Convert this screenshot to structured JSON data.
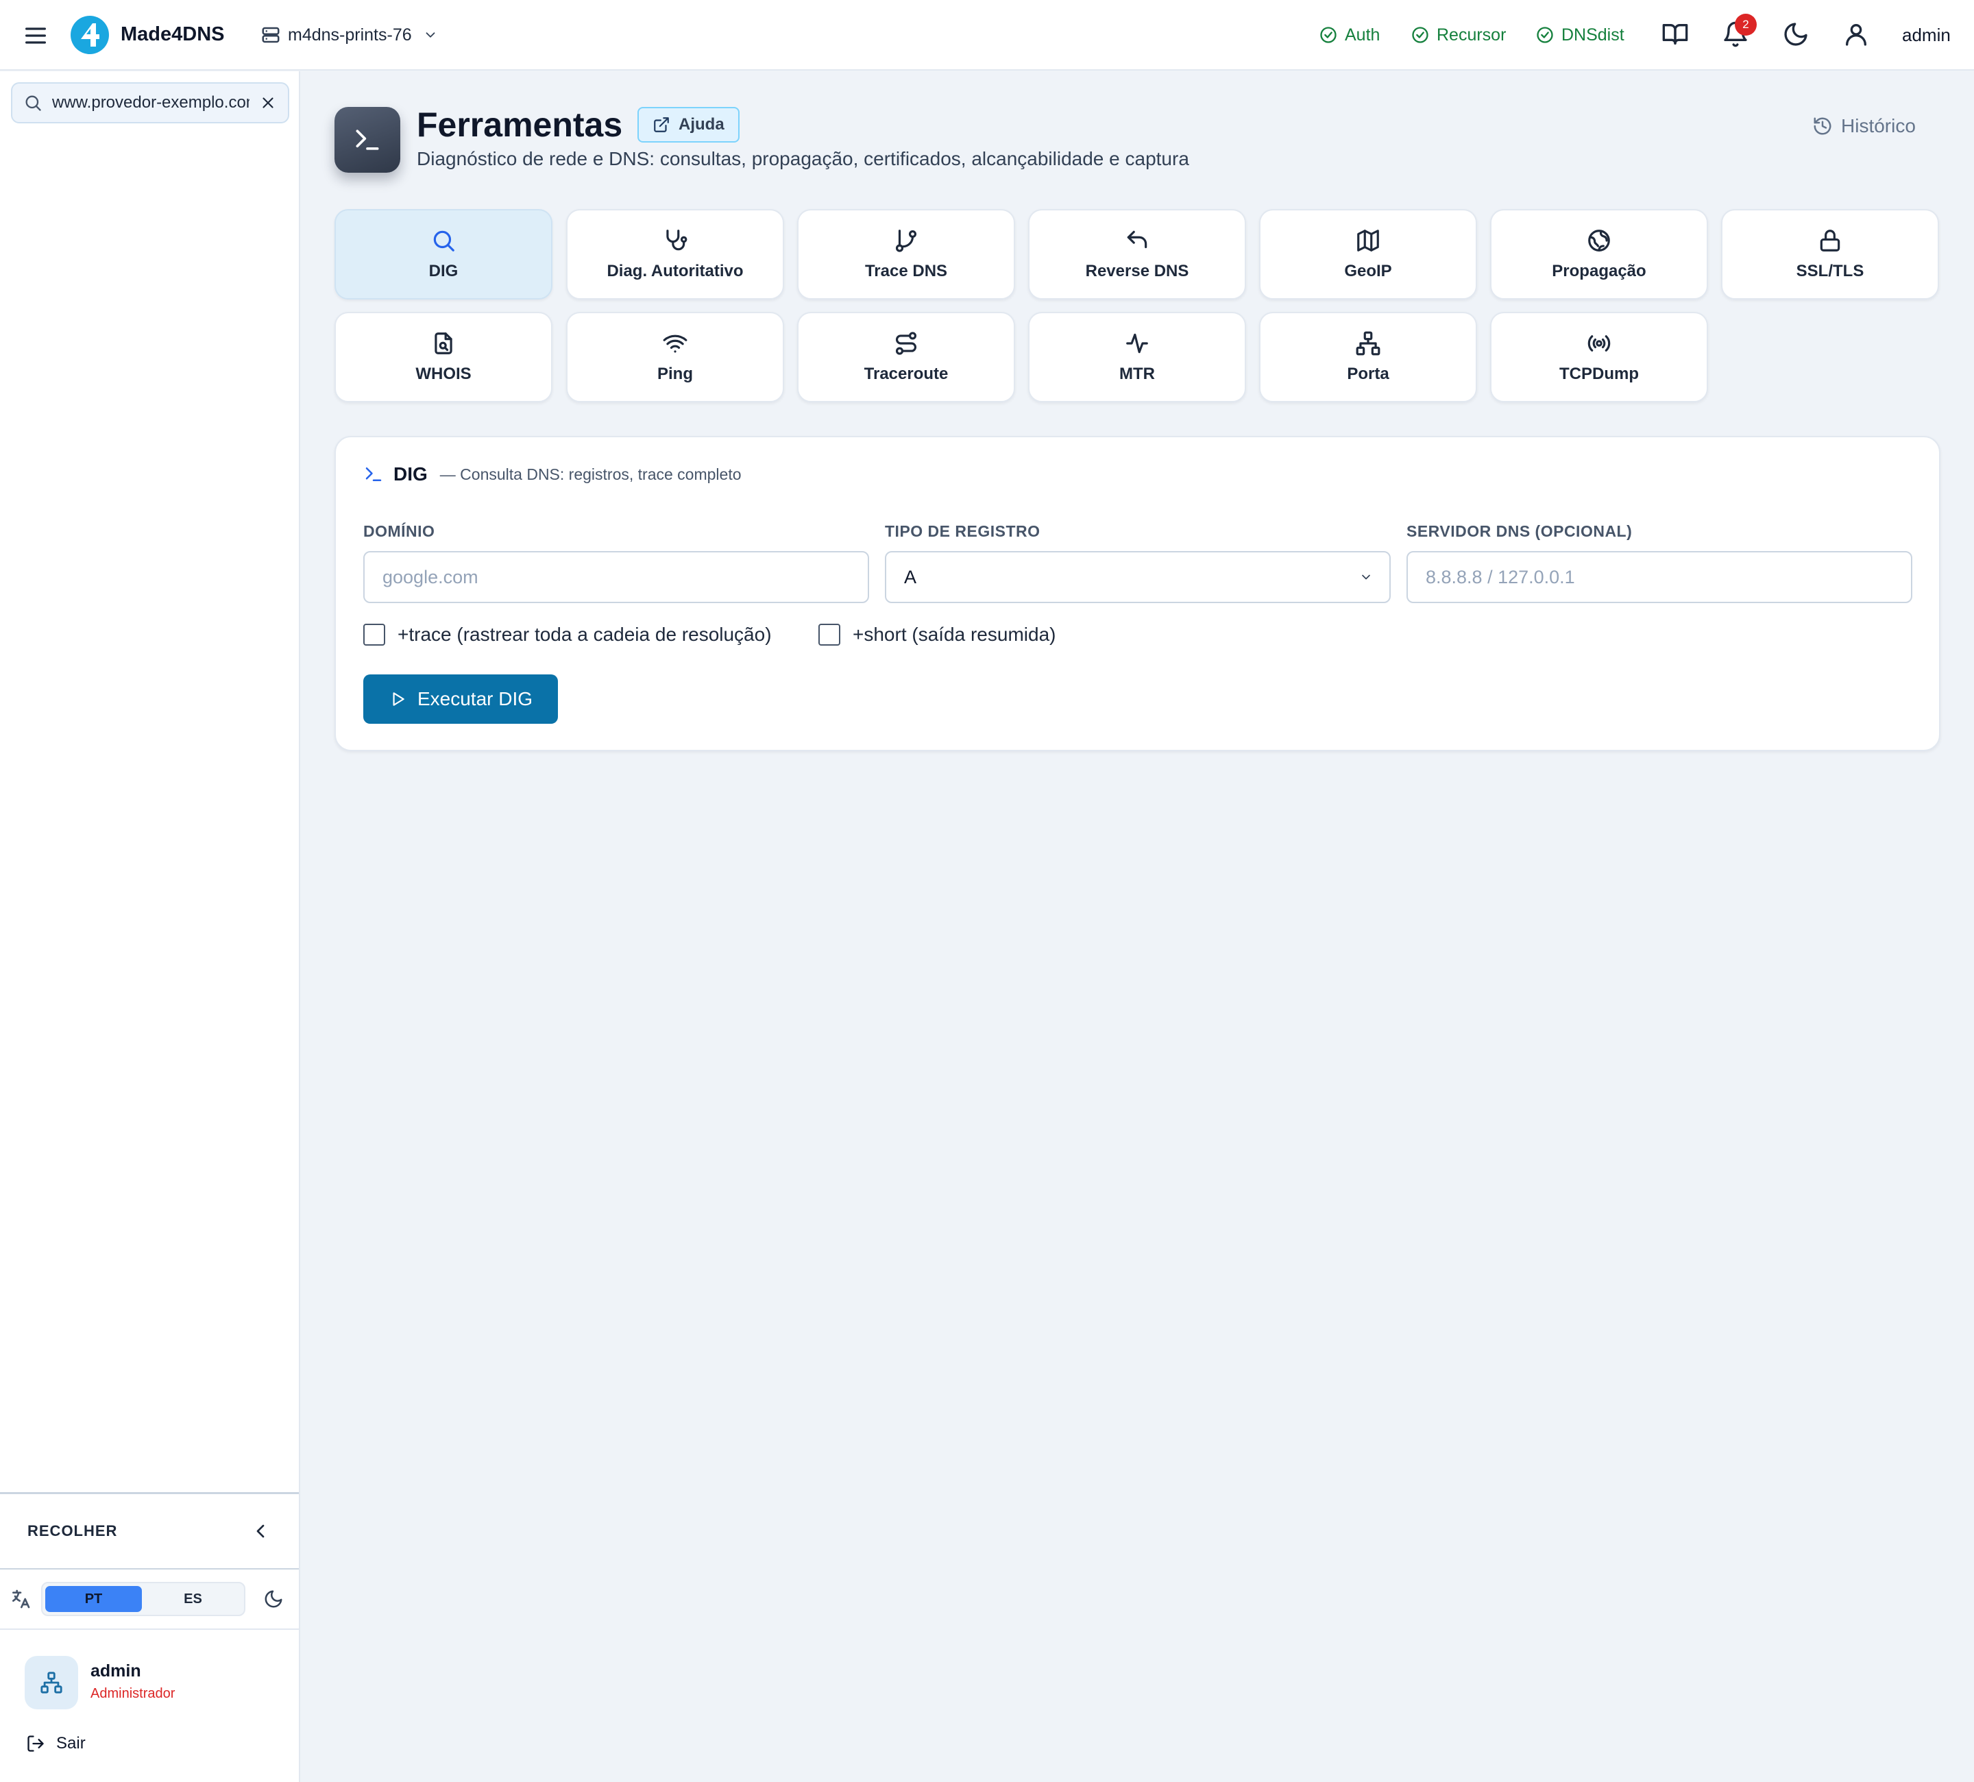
{
  "app": {
    "brand": "Made4DNS",
    "server": "m4dns-prints-76",
    "user": "admin",
    "notifications_count": "2",
    "services": [
      {
        "label": "Auth"
      },
      {
        "label": "Recursor"
      },
      {
        "label": "DNSdist"
      }
    ]
  },
  "sidebar": {
    "search": {
      "value": "www.provedor-exemplo.com.br"
    },
    "collapse_label": "RECOLHER",
    "languages": [
      "PT",
      "ES"
    ],
    "active_language": "PT",
    "user": {
      "name": "admin",
      "role": "Administrador"
    },
    "logout_label": "Sair"
  },
  "page": {
    "title": "Ferramentas",
    "help_label": "Ajuda",
    "subtitle": "Diagnóstico de rede e DNS: consultas, propagação, certificados, alcançabilidade e captura",
    "history_label": "Histórico"
  },
  "tools": [
    {
      "label": "DIG",
      "icon": "search-icon",
      "active": true
    },
    {
      "label": "Diag. Autoritativo",
      "icon": "stethoscope-icon"
    },
    {
      "label": "Trace DNS",
      "icon": "git-branch-icon"
    },
    {
      "label": "Reverse DNS",
      "icon": "undo-arrow-icon"
    },
    {
      "label": "GeoIP",
      "icon": "map-icon"
    },
    {
      "label": "Propagação",
      "icon": "globe-icon"
    },
    {
      "label": "SSL/TLS",
      "icon": "lock-icon"
    },
    {
      "label": "WHOIS",
      "icon": "file-search-icon"
    },
    {
      "label": "Ping",
      "icon": "wifi-icon"
    },
    {
      "label": "Traceroute",
      "icon": "route-icon"
    },
    {
      "label": "MTR",
      "icon": "activity-icon"
    },
    {
      "label": "Porta",
      "icon": "network-icon"
    },
    {
      "label": "TCPDump",
      "icon": "radio-icon"
    }
  ],
  "form": {
    "title": "DIG",
    "description": "— Consulta DNS: registros, trace completo",
    "domain_label": "DOMÍNIO",
    "domain_placeholder": "google.com",
    "record_type_label": "TIPO DE REGISTRO",
    "record_type_value": "A",
    "server_label": "SERVIDOR DNS (OPCIONAL)",
    "server_placeholder": "8.8.8.8 / 127.0.0.1",
    "trace_label": "+trace (rastrear toda a cadeia de resolução)",
    "trace_checked": false,
    "short_label": "+short (saída resumida)",
    "short_checked": false,
    "submit_label": "Executar DIG"
  },
  "colors": {
    "accent": "#0a72a8",
    "active_tile": "#deeef9",
    "service_ok": "#15803d",
    "badge": "#dc2626",
    "role": "#dc2626"
  }
}
